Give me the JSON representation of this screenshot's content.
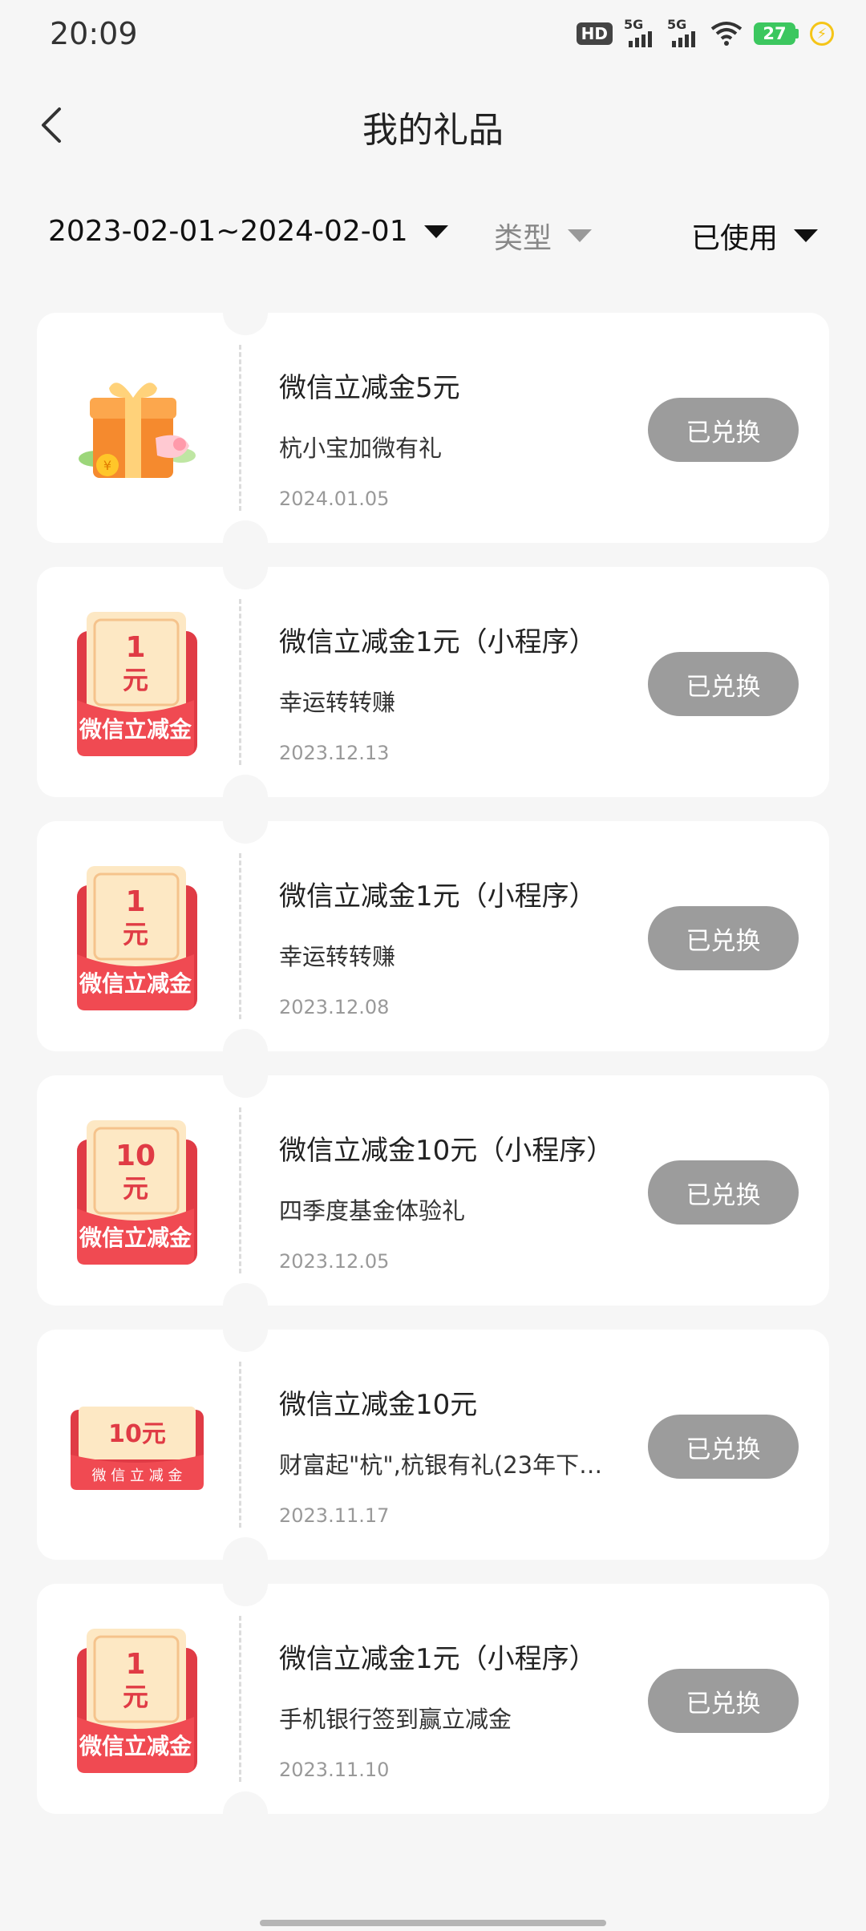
{
  "status_bar": {
    "time": "20:09",
    "hd_label": "HD",
    "net1": "5G",
    "net2": "5G",
    "battery": "27"
  },
  "header": {
    "title": "我的礼品"
  },
  "filters": {
    "date_range": "2023-02-01~2024-02-01",
    "type_label": "类型",
    "status_label": "已使用"
  },
  "gifts": [
    {
      "title": "微信立减金5元",
      "source": "杭小宝加微有礼",
      "date": "2024.01.05",
      "button": "已兑换",
      "icon": "gift-box-icon"
    },
    {
      "title": "微信立减金1元（小程序）",
      "source": "幸运转转赚",
      "date": "2023.12.13",
      "button": "已兑换",
      "icon": "red-envelope-icon",
      "amount": "1",
      "unit": "元",
      "caption": "微信立减金"
    },
    {
      "title": "微信立减金1元（小程序）",
      "source": "幸运转转赚",
      "date": "2023.12.08",
      "button": "已兑换",
      "icon": "red-envelope-icon",
      "amount": "1",
      "unit": "元",
      "caption": "微信立减金"
    },
    {
      "title": "微信立减金10元（小程序）",
      "source": "四季度基金体验礼",
      "date": "2023.12.05",
      "button": "已兑换",
      "icon": "red-envelope-icon",
      "amount": "10",
      "unit": "元",
      "caption": "微信立减金"
    },
    {
      "title": "微信立减金10元",
      "source": "财富起\"杭\",杭银有礼(23年下…",
      "date": "2023.11.17",
      "button": "已兑换",
      "icon": "red-envelope-flat-icon",
      "amount": "10元",
      "caption": "微 信 立 减 金"
    },
    {
      "title": "微信立减金1元（小程序）",
      "source": "手机银行签到赢立减金",
      "date": "2023.11.10",
      "button": "已兑换",
      "icon": "red-envelope-icon",
      "amount": "1",
      "unit": "元",
      "caption": "微信立减金"
    }
  ],
  "colors": {
    "envelope_red": "#f04a52",
    "envelope_cream": "#fde8c4",
    "button_gray": "#9c9c9c"
  }
}
